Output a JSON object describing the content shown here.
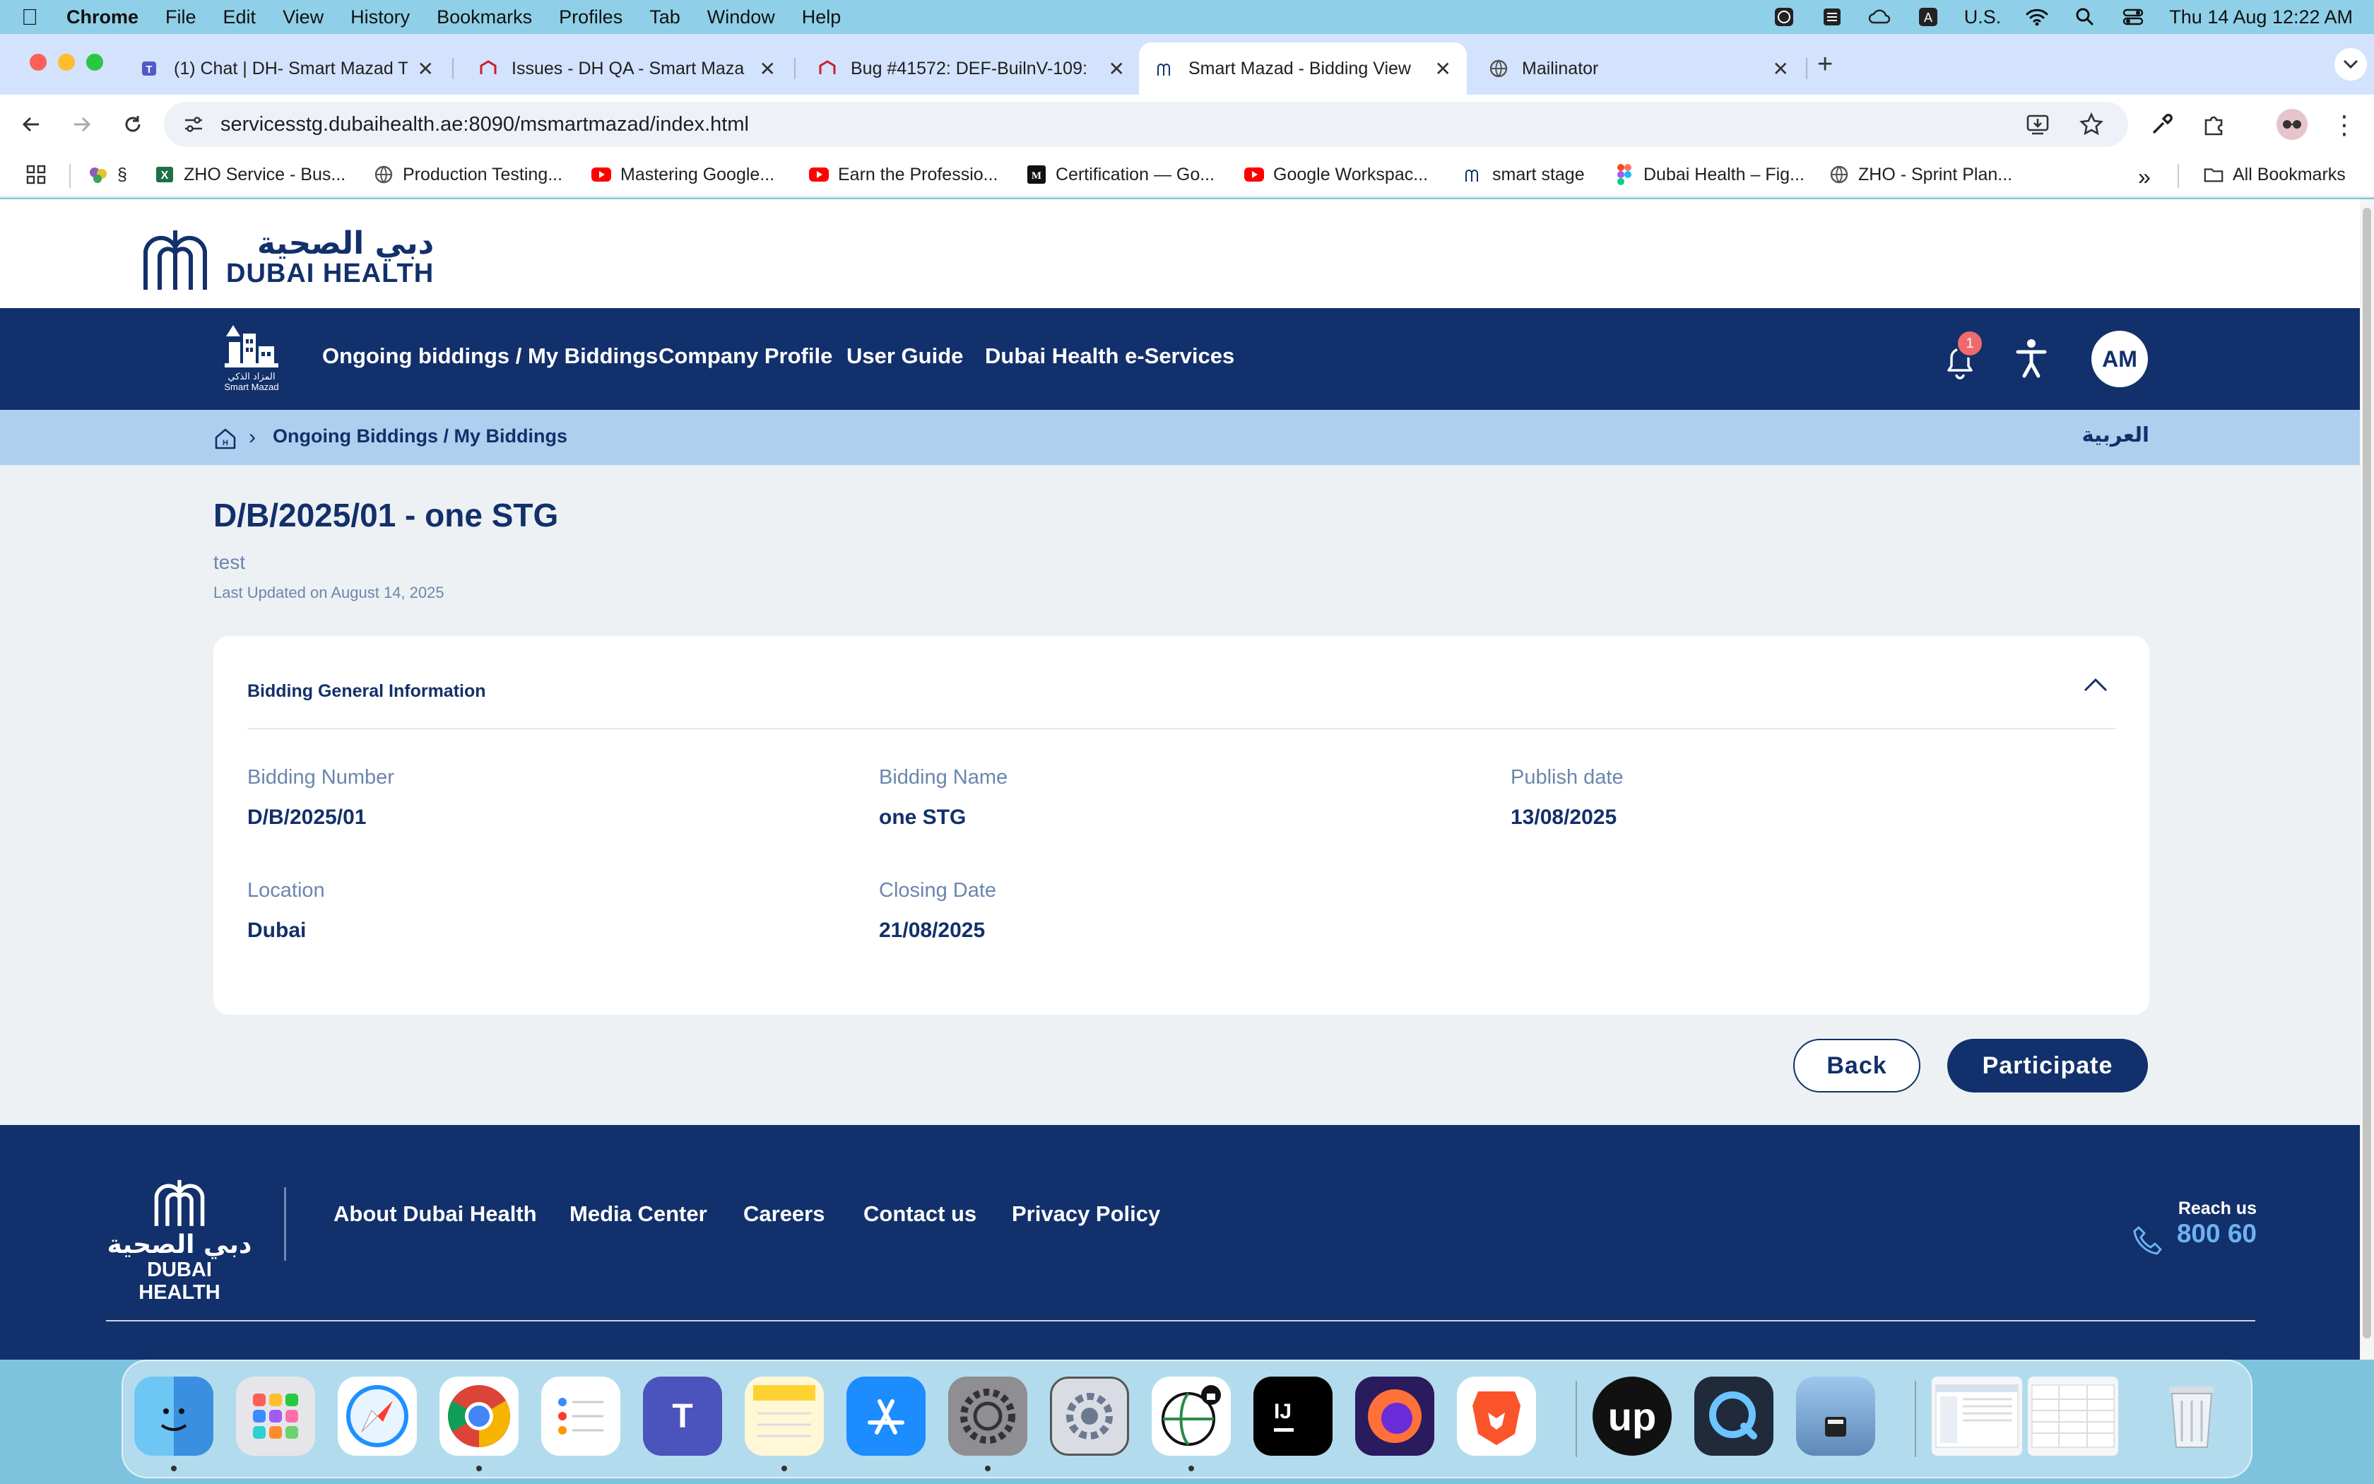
{
  "menubar": {
    "app": "Chrome",
    "items": [
      "File",
      "Edit",
      "View",
      "History",
      "Bookmarks",
      "Profiles",
      "Tab",
      "Window",
      "Help"
    ],
    "input_source": "U.S.",
    "clock": "Thu 14 Aug  12:22 AM"
  },
  "tabs": [
    {
      "title": "(1) Chat | DH- Smart Mazad T"
    },
    {
      "title": "Issues - DH QA - Smart Maza"
    },
    {
      "title": "Bug #41572: DEF-BuilnV-109:"
    },
    {
      "title": "Smart Mazad - Bidding View"
    },
    {
      "title": "Mailinator"
    }
  ],
  "toolbar": {
    "url": "servicesstg.dubaihealth.ae:8090/msmartmazad/index.html"
  },
  "bookmarks": {
    "items": [
      {
        "label": "§"
      },
      {
        "label": "ZHO Service - Bus..."
      },
      {
        "label": "Production Testing..."
      },
      {
        "label": "Mastering Google..."
      },
      {
        "label": "Earn the Professio..."
      },
      {
        "label": "Certification — Go..."
      },
      {
        "label": "Google Workspac..."
      },
      {
        "label": "smart stage"
      },
      {
        "label": "Dubai Health – Fig..."
      },
      {
        "label": "ZHO - Sprint Plan..."
      }
    ],
    "more": "»",
    "all": "All Bookmarks"
  },
  "brand": {
    "arabic": "دبي الصحية",
    "english": "DUBAI HEALTH"
  },
  "smart_logo": {
    "arabic": "المزاد الذكي",
    "english": "Smart Mazad"
  },
  "nav": {
    "links": [
      "Ongoing biddings / My Biddings",
      "Company Profile",
      "User Guide",
      "Dubai Health e-Services"
    ],
    "notification_count": "1",
    "avatar_initials": "AM"
  },
  "breadcrumb": {
    "current": "Ongoing Biddings / My Biddings",
    "language_toggle": "العربية"
  },
  "page": {
    "title": "D/B/2025/01 - one STG",
    "subtitle": "test",
    "last_updated": "Last Updated on August 14, 2025"
  },
  "card": {
    "heading": "Bidding General Information",
    "fields": [
      {
        "label": "Bidding Number",
        "value": "D/B/2025/01"
      },
      {
        "label": "Bidding Name",
        "value": "one STG"
      },
      {
        "label": "Publish date",
        "value": "13/08/2025"
      },
      {
        "label": "Location",
        "value": "Dubai"
      },
      {
        "label": "Closing Date",
        "value": "21/08/2025"
      }
    ]
  },
  "actions": {
    "back": "Back",
    "participate": "Participate"
  },
  "footer": {
    "links": [
      "About Dubai Health",
      "Media Center",
      "Careers",
      "Contact us",
      "Privacy Policy"
    ],
    "reach_label": "Reach us",
    "reach_number": "800 60"
  },
  "colors": {
    "brand_navy": "#12306b",
    "breadcrumb_bg": "#aed0ee",
    "muted_label": "#6b86ad",
    "badge_red": "#ef6b6b",
    "phone_blue": "#6cb3f0"
  }
}
